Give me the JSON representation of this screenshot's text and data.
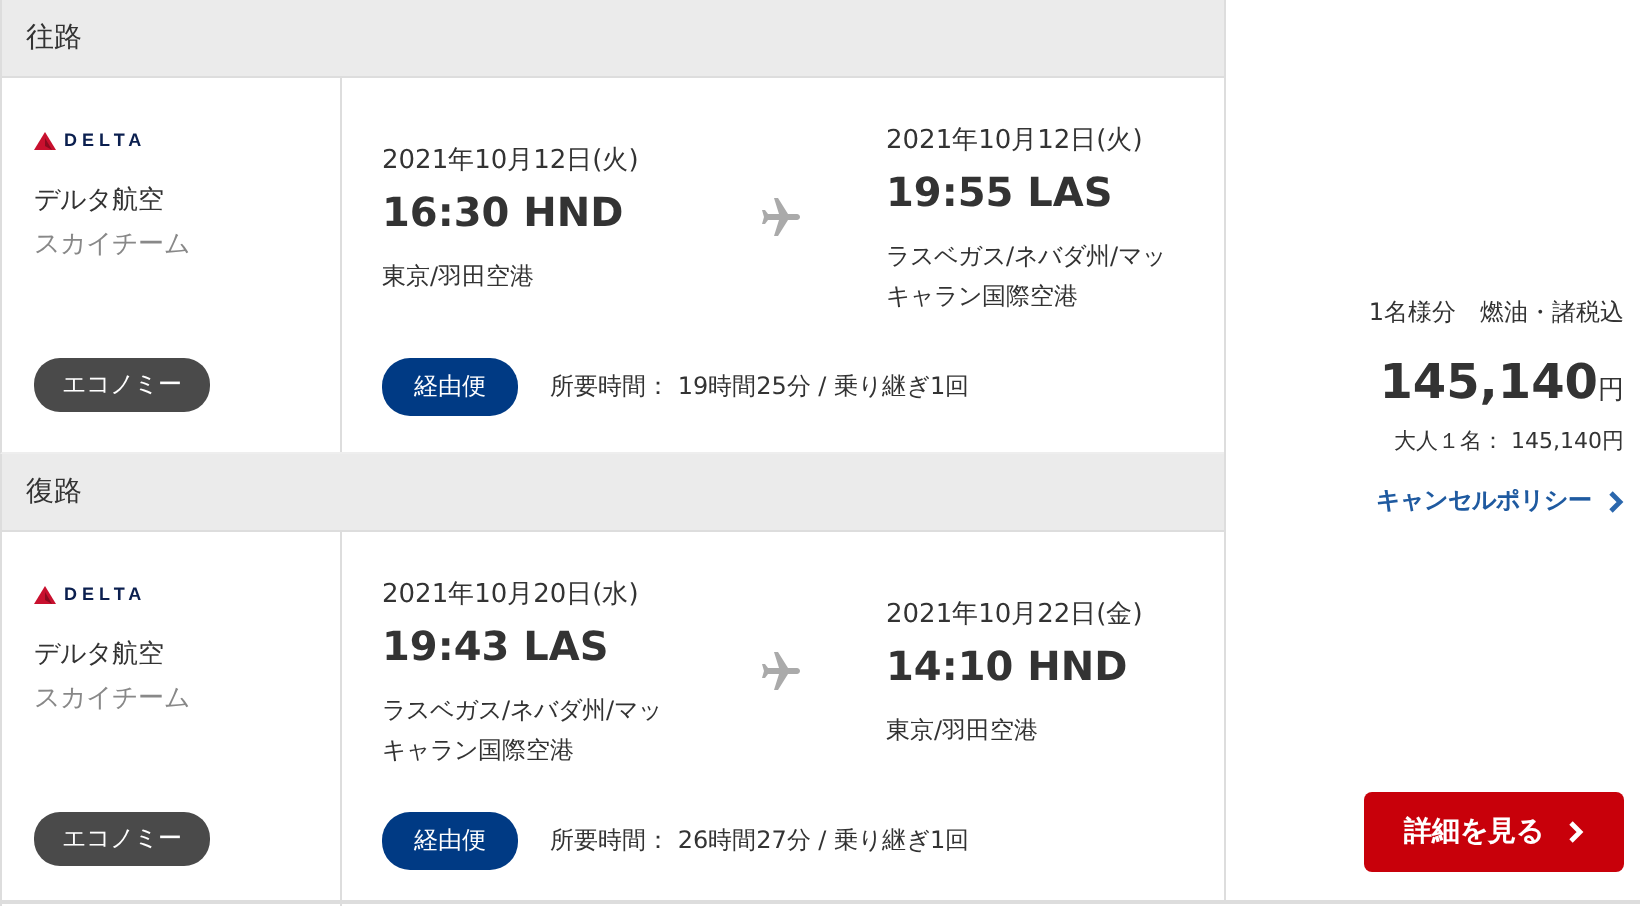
{
  "legs": [
    {
      "heading": "往路",
      "airline": {
        "logo": "DELTA",
        "name": "デルタ航空",
        "alliance": "スカイチーム"
      },
      "cabin": "エコノミー",
      "departure": {
        "date": "2021年10月12日(火)",
        "time": "16:30 HND",
        "airport": "東京/羽田空港"
      },
      "arrival": {
        "date": "2021年10月12日(火)",
        "time": "19:55 LAS",
        "airport": "ラスベガス/ネバダ州/マッキャラン国際空港"
      },
      "route_type": "経由便",
      "duration": "所要時間： 19時間25分 / 乗り継ぎ1回"
    },
    {
      "heading": "復路",
      "airline": {
        "logo": "DELTA",
        "name": "デルタ航空",
        "alliance": "スカイチーム"
      },
      "cabin": "エコノミー",
      "departure": {
        "date": "2021年10月20日(水)",
        "time": "19:43 LAS",
        "airport": "ラスベガス/ネバダ州/マッキャラン国際空港"
      },
      "arrival": {
        "date": "2021年10月22日(金)",
        "time": "14:10 HND",
        "airport": "東京/羽田空港"
      },
      "route_type": "経由便",
      "duration": "所要時間： 26時間27分 / 乗り継ぎ1回"
    }
  ],
  "price": {
    "note": "1名様分　燃油・諸税込",
    "amount": "145,140",
    "currency": "円",
    "breakdown": "大人１名： 145,140円",
    "cancel_link": "キャンセルポリシー",
    "details_button": "詳細を見る"
  }
}
